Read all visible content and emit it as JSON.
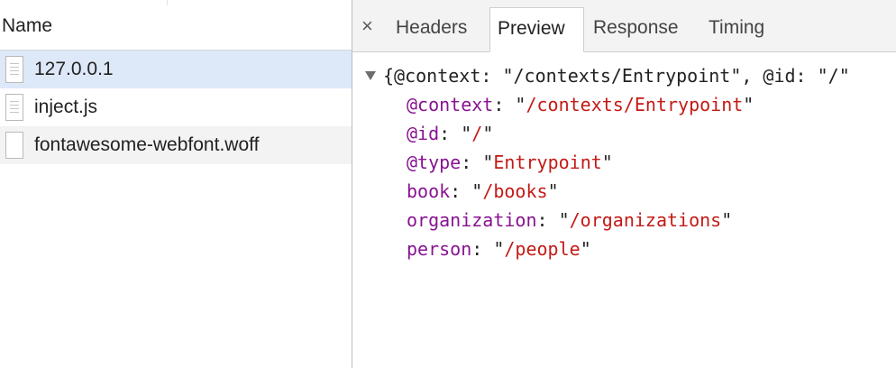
{
  "requests": {
    "column_header": "Name",
    "items": [
      {
        "name": "127.0.0.1",
        "selected": true
      },
      {
        "name": "inject.js",
        "selected": false
      },
      {
        "name": "fontawesome-webfont.woff",
        "selected": false
      }
    ]
  },
  "tabs": {
    "close_symbol": "×",
    "items": [
      {
        "label": "Headers",
        "active": false
      },
      {
        "label": "Preview",
        "active": true
      },
      {
        "label": "Response",
        "active": false
      },
      {
        "label": "Timing",
        "active": false
      }
    ]
  },
  "preview": {
    "summary": "{@context: \"/contexts/Entrypoint\", @id: \"/\"",
    "properties": [
      {
        "key": "@context",
        "value": "/contexts/Entrypoint"
      },
      {
        "key": "@id",
        "value": "/"
      },
      {
        "key": "@type",
        "value": "Entrypoint"
      },
      {
        "key": "book",
        "value": "/books"
      },
      {
        "key": "organization",
        "value": "/organizations"
      },
      {
        "key": "person",
        "value": "/people"
      }
    ]
  },
  "colors": {
    "key": "#881391",
    "string": "#c41a16",
    "selected_row": "#dde8f8"
  }
}
